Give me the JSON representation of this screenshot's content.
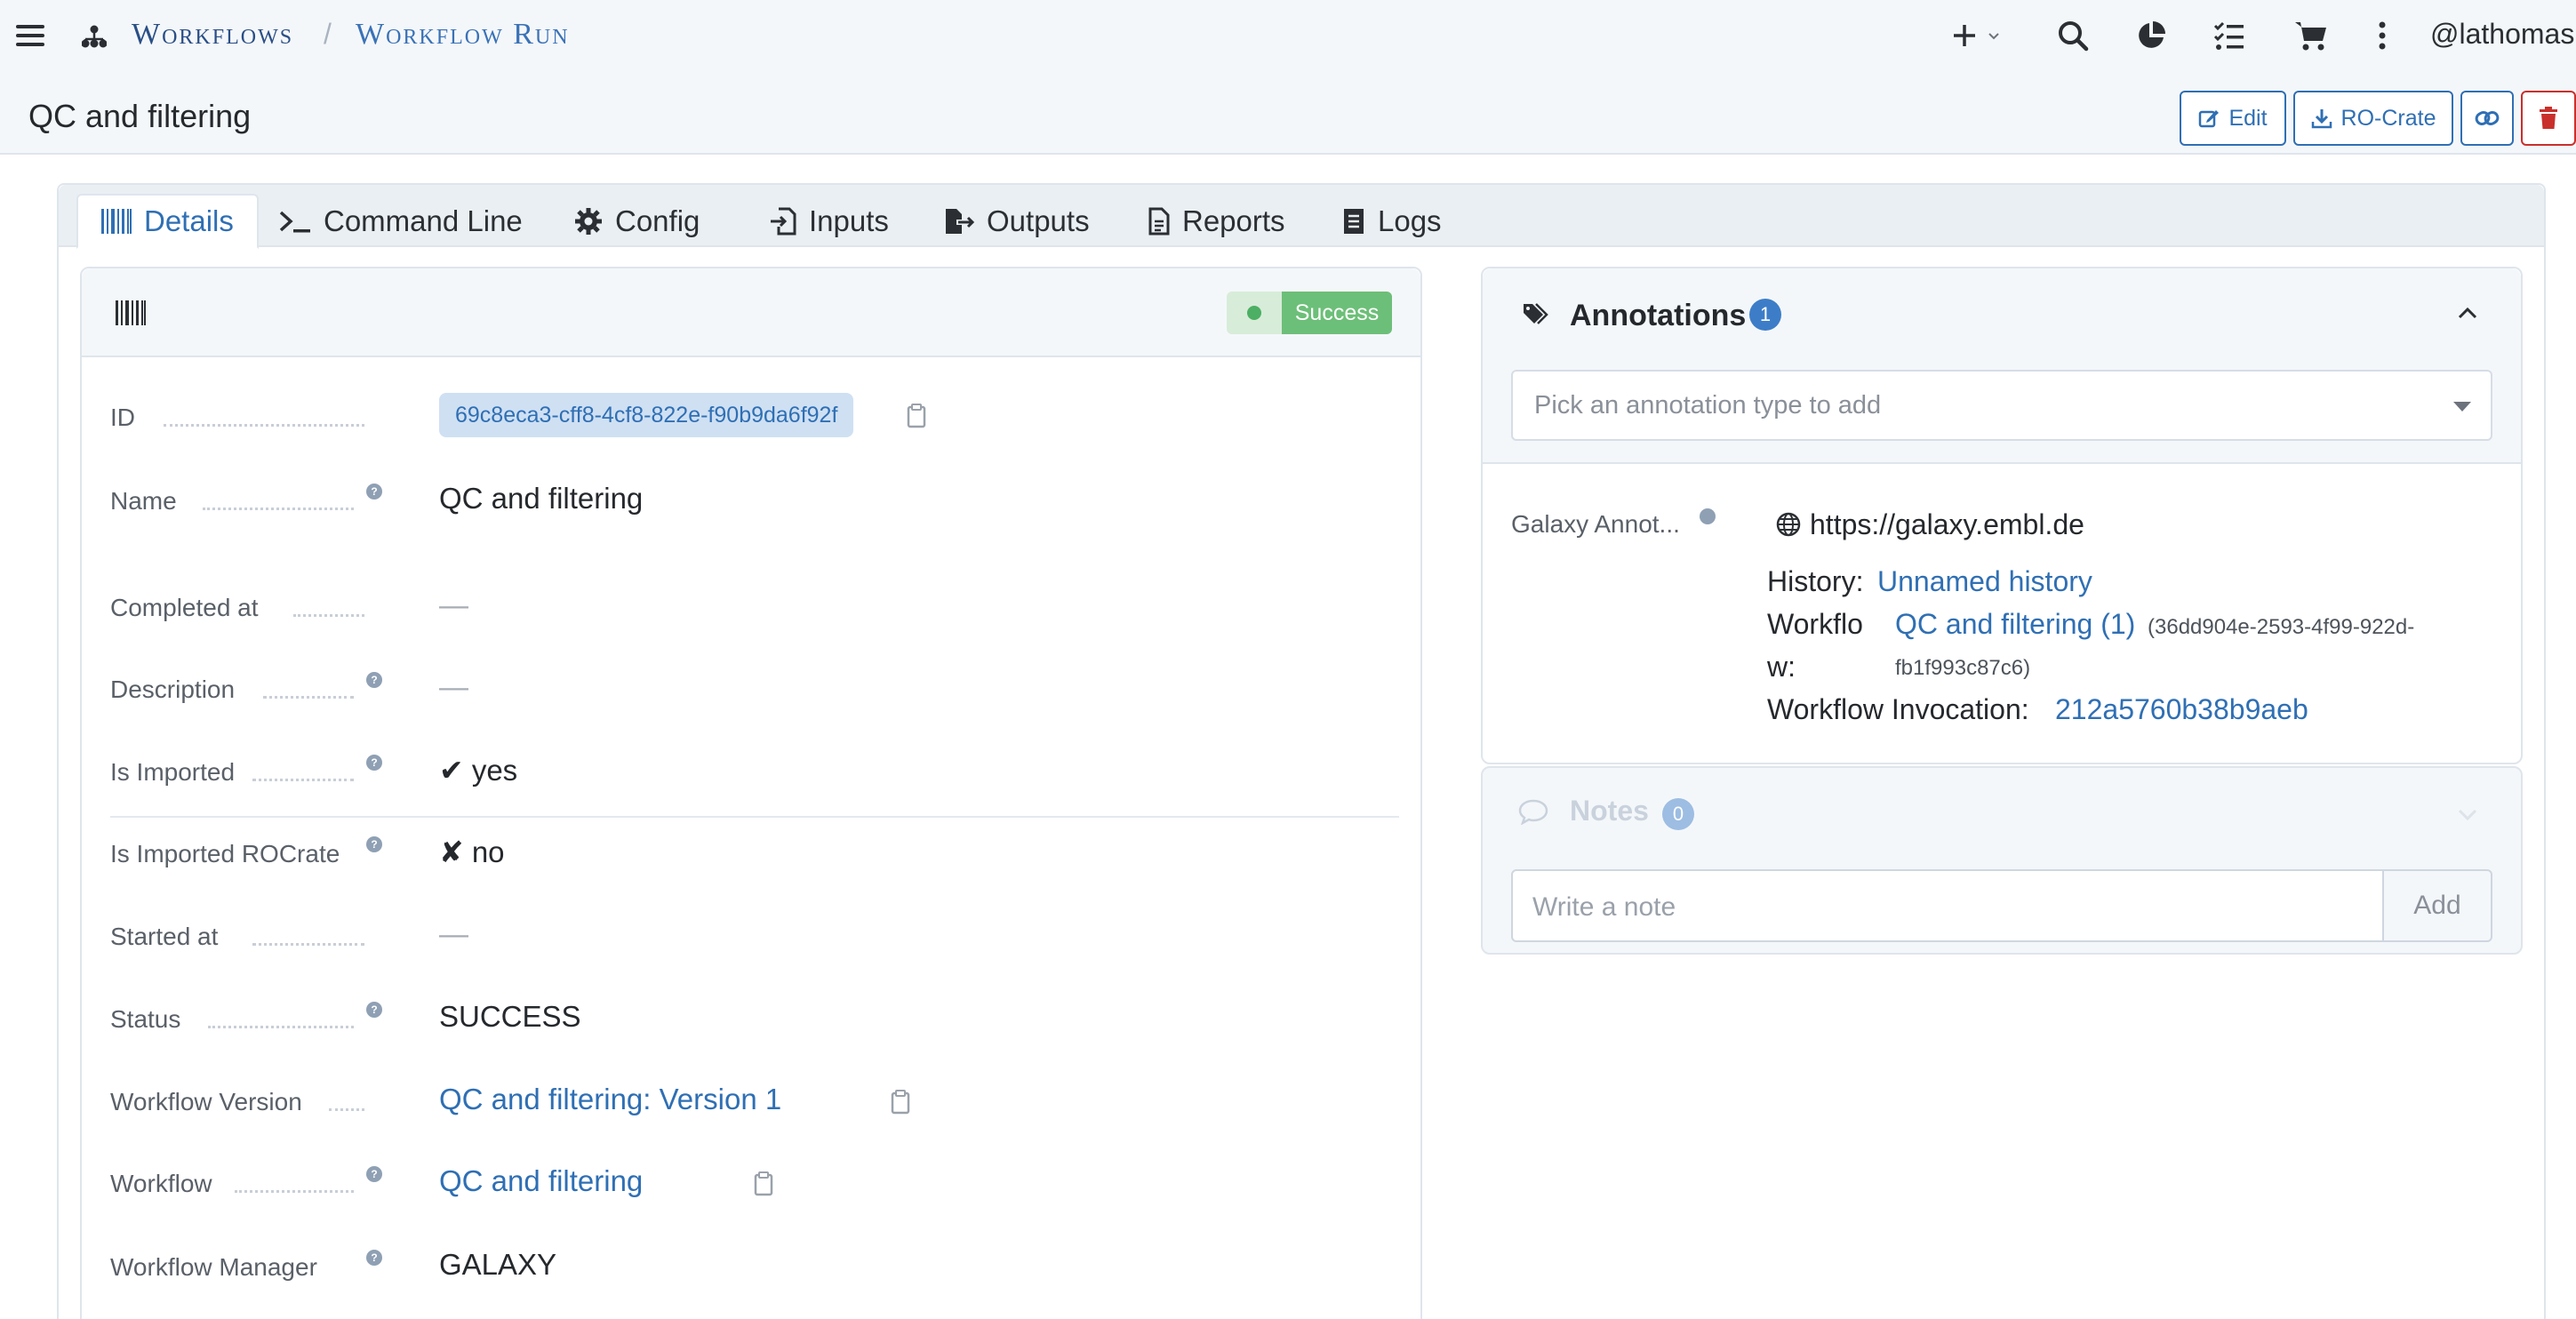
{
  "nav": {
    "crumb_one": "Workflows",
    "crumb_sep": "/",
    "crumb_two": "Workflow Run",
    "user": "@lathomas"
  },
  "page": {
    "title": "QC and filtering",
    "buttons": {
      "edit": "Edit",
      "rocrate": "RO-Crate"
    }
  },
  "tabs": [
    {
      "label": "Details"
    },
    {
      "label": "Command Line"
    },
    {
      "label": "Config"
    },
    {
      "label": "Inputs"
    },
    {
      "label": "Outputs"
    },
    {
      "label": "Reports"
    },
    {
      "label": "Logs"
    }
  ],
  "details": {
    "status_badge": "Success",
    "rows": [
      {
        "label": "ID",
        "value": "69c8eca3-cff8-4cf8-822e-f90b9da6f92f"
      },
      {
        "label": "Name",
        "value": "QC and filtering"
      },
      {
        "label": "Completed at",
        "value": "—"
      },
      {
        "label": "Description",
        "value": "—"
      },
      {
        "label": "Is Imported",
        "value": "✔ yes"
      },
      {
        "label": "Is Imported ROCrate",
        "value": "✘ no"
      },
      {
        "label": "Started at",
        "value": "—"
      },
      {
        "label": "Status",
        "value": "SUCCESS"
      },
      {
        "label": "Workflow Version",
        "value": "QC and filtering: Version 1"
      },
      {
        "label": "Workflow",
        "value": "QC and filtering"
      },
      {
        "label": "Workflow Manager",
        "value": "GALAXY"
      }
    ]
  },
  "annotations": {
    "title": "Annotations",
    "count": "1",
    "picker_placeholder": "Pick an annotation type to add",
    "item": {
      "label": "Galaxy Annot...",
      "server": "https://galaxy.embl.de",
      "history_label": "History:",
      "history_value": "Unnamed history",
      "workflow_label_1": "Workflo",
      "workflow_label_2": "w:",
      "workflow_value": "QC and filtering (1)",
      "workflow_id_1": "(36dd904e-2593-4f99-922d-",
      "workflow_id_2": "fb1f993c87c6)",
      "invocation_label": "Workflow Invocation:",
      "invocation_value": "212a5760b38b9aeb"
    }
  },
  "notes": {
    "title": "Notes",
    "count": "0",
    "placeholder": "Write a note",
    "add_label": "Add"
  },
  "colors": {
    "accent": "#2f6fb4",
    "success": "#6cbf78",
    "danger": "#c9302c",
    "badge": "#3d7dc8"
  }
}
